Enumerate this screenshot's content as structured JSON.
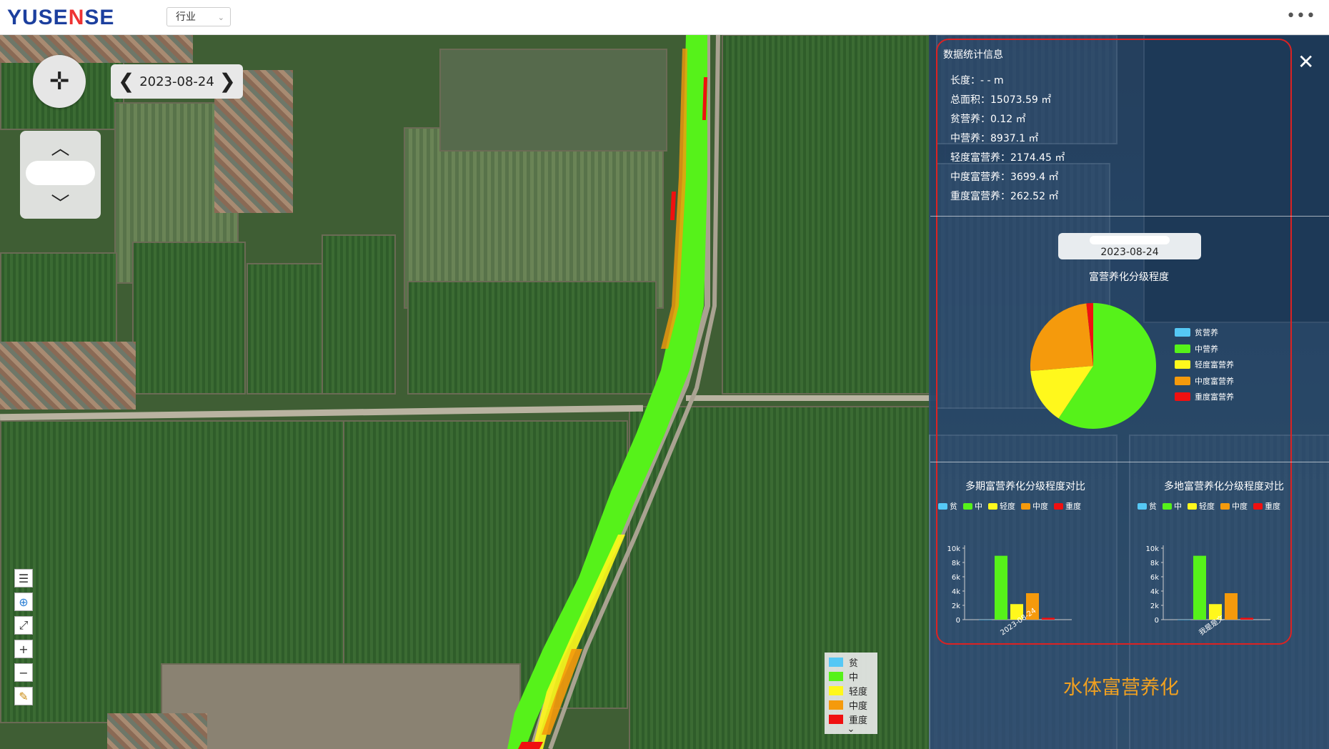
{
  "header": {
    "logo_text_a": "YUSE",
    "logo_text_b": "N",
    "logo_text_c": "SE",
    "industry_select": "行业",
    "more_label": "•••"
  },
  "map": {
    "date": "2023-08-24",
    "prev_label": "❮",
    "next_label": "❯",
    "legend": [
      {
        "label": "贫",
        "color": "#55c8f5"
      },
      {
        "label": "中",
        "color": "#56f21a"
      },
      {
        "label": "轻度",
        "color": "#fff81c"
      },
      {
        "label": "中度",
        "color": "#f59a0c"
      },
      {
        "label": "重度",
        "color": "#f01010"
      }
    ]
  },
  "panel": {
    "stats_title": "数据统计信息",
    "stats": [
      {
        "label": "长度：",
        "value": "- - m"
      },
      {
        "label": "总面积：",
        "value": "15073.59 ㎡"
      },
      {
        "label": "贫营养：",
        "value": "0.12 ㎡"
      },
      {
        "label": "中营养：",
        "value": "8937.1 ㎡"
      },
      {
        "label": "轻度富营养：",
        "value": "2174.45 ㎡"
      },
      {
        "label": "中度富营养：",
        "value": "3699.4 ㎡"
      },
      {
        "label": "重度富营养：",
        "value": "262.52 ㎡"
      }
    ],
    "pie_date": "2023-08-24",
    "pie_title": "富营养化分级程度",
    "pie_legend": [
      "贫营养",
      "中营养",
      "轻度富营养",
      "中度富营养",
      "重度富营养"
    ],
    "bar_left_title": "多期富营养化分级程度对比",
    "bar_right_title": "多地富营养化分级程度对比",
    "bar_legend": [
      "贫",
      "中",
      "轻度",
      "中度",
      "重度"
    ],
    "footer_title": "水体富营养化"
  },
  "colors": {
    "poor": "#55c8f5",
    "mid": "#56f21a",
    "light": "#fff81c",
    "moderate": "#f59a0c",
    "heavy": "#f01010"
  },
  "chart_data": [
    {
      "type": "pie",
      "title": "富营养化分级程度",
      "categories": [
        "贫营养",
        "中营养",
        "轻度富营养",
        "中度富营养",
        "重度富营养"
      ],
      "values": [
        0.12,
        8937.1,
        2174.45,
        3699.4,
        262.52
      ],
      "legend_position": "right"
    },
    {
      "type": "bar",
      "title": "多期富营养化分级程度对比",
      "categories": [
        "2023-08-24"
      ],
      "series": [
        {
          "name": "贫",
          "values": [
            0.12
          ]
        },
        {
          "name": "中",
          "values": [
            8937.1
          ]
        },
        {
          "name": "轻度",
          "values": [
            2174.45
          ]
        },
        {
          "name": "中度",
          "values": [
            3699.4
          ]
        },
        {
          "name": "重度",
          "values": [
            262.52
          ]
        }
      ],
      "yticks": [
        "0",
        "2k",
        "4k",
        "6k",
        "8k",
        "10k"
      ],
      "ylim": [
        0,
        10000
      ]
    },
    {
      "type": "bar",
      "title": "多地富营养化分级程度对比",
      "categories": [
        "我是是文"
      ],
      "series": [
        {
          "name": "贫",
          "values": [
            0.12
          ]
        },
        {
          "name": "中",
          "values": [
            8937.1
          ]
        },
        {
          "name": "轻度",
          "values": [
            2174.45
          ]
        },
        {
          "name": "中度",
          "values": [
            3699.4
          ]
        },
        {
          "name": "重度",
          "values": [
            262.52
          ]
        }
      ],
      "yticks": [
        "0",
        "2k",
        "4k",
        "6k",
        "8k",
        "10k"
      ],
      "ylim": [
        0,
        10000
      ]
    }
  ]
}
